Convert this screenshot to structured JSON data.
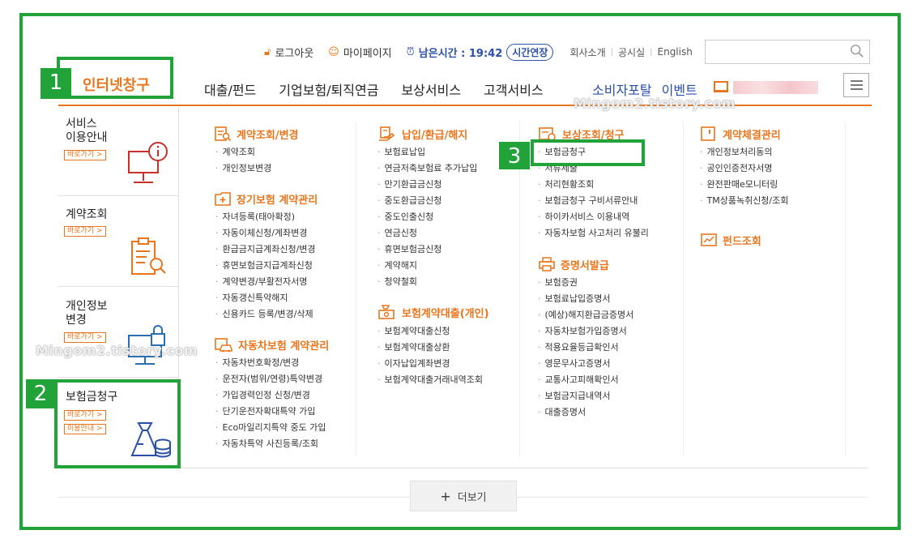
{
  "header": {
    "logout": "로그아웃",
    "mypage": "마이페이지",
    "remaining_label": "남은시간 : 19:42",
    "extend": "시간연장",
    "links": [
      "회사소개",
      "공시실",
      "English"
    ],
    "search_placeholder": ""
  },
  "logo": "인터넷창구",
  "nav": {
    "main": [
      "대출/펀드",
      "기업보험/퇴직연금",
      "보상서비스",
      "고객서비스"
    ],
    "right": [
      "소비자포탈",
      "이벤트"
    ]
  },
  "watermark": "Mingom2.tistory.com",
  "sidebar": [
    {
      "title": "서비스\n이용안내",
      "chips": [
        "바로가기 >"
      ],
      "icon": "monitor-info-icon"
    },
    {
      "title": "계약조회",
      "chips": [
        "바로가기 >"
      ],
      "icon": "clipboard-search-icon"
    },
    {
      "title": "개인정보\n변경",
      "chips": [
        "바로가기 >"
      ],
      "icon": "monitor-lock-icon"
    },
    {
      "title": "보험금청구",
      "chips": [
        "바로가기 >",
        "이용안내 >"
      ],
      "icon": "money-bag-coins-icon"
    }
  ],
  "columns": {
    "col1": {
      "sections": [
        {
          "title": "계약조회/변경",
          "icon": "document-search-icon",
          "items": [
            "계약조회",
            "개인정보변경"
          ]
        },
        {
          "title": "장기보험 계약관리",
          "icon": "folder-plus-icon",
          "items": [
            "자녀등록(태아확정)",
            "자동이체신청/계좌변경",
            "환급금지급계좌신청/변경",
            "휴면보험금지급계좌신청",
            "계약변경/부활전자서명",
            "자동갱신특약해지",
            "신용카드 등록/변경/삭제"
          ]
        },
        {
          "title": "자동차보험 계약관리",
          "icon": "car-document-icon",
          "items": [
            "자동차번호확정/변경",
            "운전자(범위/연령)특약변경",
            "가입경력인정 신청/변경",
            "단기운전자확대특약 가입",
            "Eco마일리지특약 중도 가입",
            "자동차특약 사진등록/조회"
          ]
        }
      ]
    },
    "col2": {
      "sections": [
        {
          "title": "납입/환급/해지",
          "icon": "bill-hand-icon",
          "items": [
            "보험료납입",
            "연금저축보험료 추가납입",
            "만기환급금신청",
            "중도환급금신청",
            "중도인출신청",
            "연금신청",
            "휴면보험금신청",
            "계약해지",
            "청약철회"
          ]
        },
        {
          "title": "보험계약대출(개인)",
          "icon": "money-loan-icon",
          "items": [
            "보험계약대출신청",
            "보험계약대출상환",
            "이자납입계좌변경",
            "보험계약대출거래내역조회"
          ]
        }
      ]
    },
    "col3": {
      "sections": [
        {
          "title": "보상조회/청구",
          "icon": "compensation-icon",
          "items": [
            "보험금청구",
            "서류제출",
            "처리현황조회",
            "보험금청구 구비서류안내",
            "하이카서비스 이용내역",
            "자동차보험 사고처리 유불리"
          ]
        },
        {
          "title": "증명서발급",
          "icon": "printer-icon",
          "items": [
            "보험증권",
            "보험료납입증명서",
            "(예상)해지환급금증명서",
            "자동차보험가입증명서",
            "적용요율등급확인서",
            "영문무사고증명서",
            "교통사고피해확인서",
            "보험금지급내역서",
            "대출증명서"
          ]
        }
      ]
    },
    "col4": {
      "sections": [
        {
          "title": "계약체결관리",
          "icon": "contract-icon",
          "items": [
            "개인정보처리동의",
            "공인인증전자서명",
            "완전판매e모니터링",
            "TM상품녹취신청/조회"
          ]
        },
        {
          "title": "펀드조회",
          "icon": "chart-icon",
          "items": []
        }
      ]
    }
  },
  "more_button": "더보기",
  "annotations": [
    "1",
    "2",
    "3"
  ]
}
